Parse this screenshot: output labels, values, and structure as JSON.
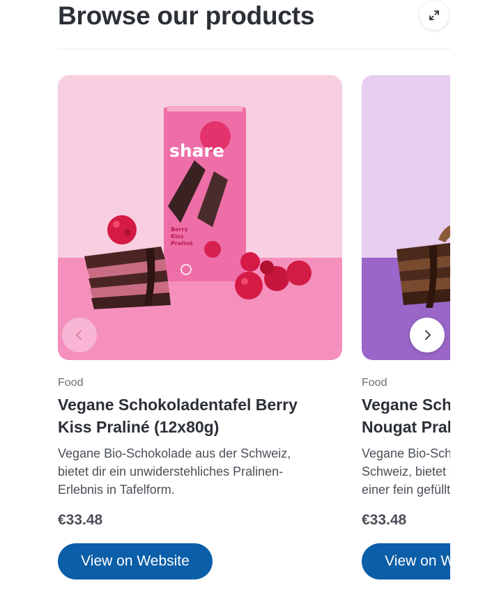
{
  "header": {
    "title": "Browse our products",
    "expand_icon": "expand-arrows-icon"
  },
  "carousel": {
    "prev_icon": "chevron-left-icon",
    "next_icon": "chevron-right-icon",
    "items": [
      {
        "category": "Food",
        "title": "Vegane Schokoladentafel Berry\nKiss Praliné (12x80g)",
        "description": "Vegane Bio-Schokolade aus der Schweiz,\nbietet dir ein unwiderstehliches Pralinen-\nErlebnis in Tafelform.",
        "price": "€33.48",
        "cta_label": "View on Website",
        "image": {
          "brand": "share",
          "flavor": "Berry Kiss Praliné",
          "background_top": "#f8cfe0",
          "background_bottom": "#f590bd"
        }
      },
      {
        "category": "Food",
        "title": "Vegane Schokoladentafel\nNougat Praliné",
        "description": "Vegane Bio-Schokolade aus der\nSchweiz, bietet dir ein Erlebnis mit\neiner fein gefüllten Praline.",
        "price": "€33.48",
        "cta_label": "View on Website",
        "image": {
          "background_top": "#e7cdef",
          "background_bottom": "#9a66c9"
        }
      }
    ]
  },
  "colors": {
    "accent": "#0b5ea8",
    "heading": "#2b2f36",
    "muted": "#6a6f78"
  }
}
